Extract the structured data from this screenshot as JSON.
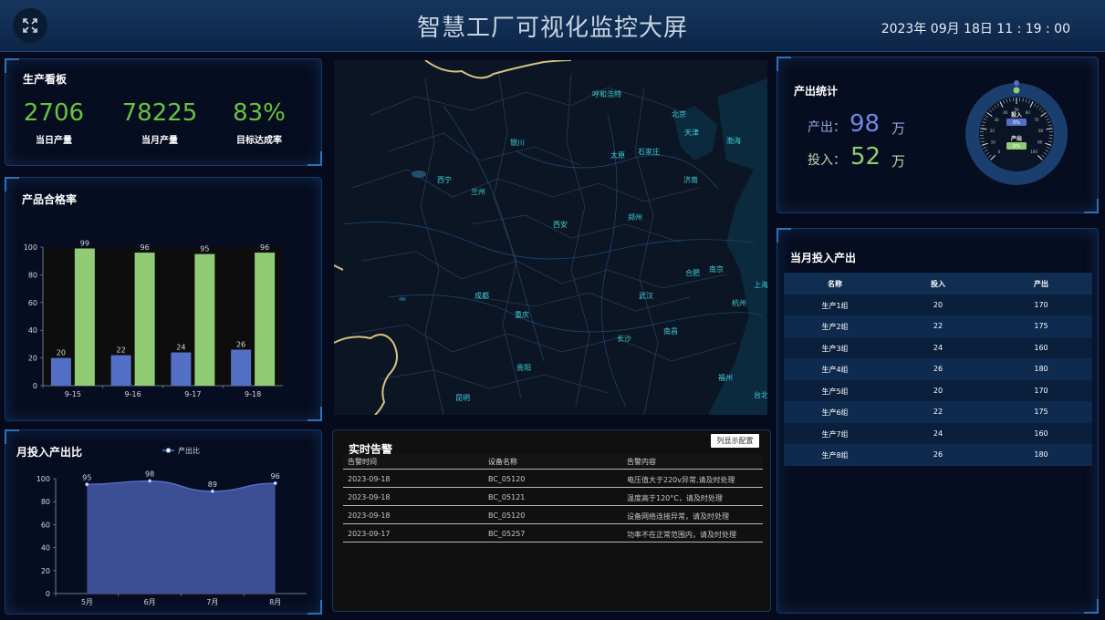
{
  "header": {
    "title": "智慧工厂可视化监控大屏",
    "datetime": "2023年 09月 18日 11 : 19 : 00"
  },
  "icons": {
    "fullscreen": "fullscreen-expand-icon"
  },
  "production_board": {
    "title": "生产看板",
    "stats": [
      {
        "value": "2706",
        "label": "当日产量"
      },
      {
        "value": "78225",
        "label": "当月产量"
      },
      {
        "value": "83%",
        "label": "目标达成率"
      }
    ]
  },
  "quality_chart": {
    "title": "产品合格率",
    "chart_data": {
      "type": "bar",
      "categories": [
        "9-15",
        "9-16",
        "9-17",
        "9-18"
      ],
      "series": [
        {
          "values": [
            20,
            22,
            24,
            26
          ],
          "color": "#5470c6"
        },
        {
          "values": [
            99,
            96,
            95,
            96
          ],
          "color": "#91cc75"
        }
      ],
      "ylim": [
        0,
        100
      ],
      "yticks": [
        0,
        20,
        40,
        60,
        80,
        100
      ]
    }
  },
  "ratio_chart": {
    "title": "月投入产出比",
    "chart_data": {
      "type": "area",
      "categories": [
        "5月",
        "6月",
        "7月",
        "8月"
      ],
      "series": [
        {
          "name": "产出比",
          "values": [
            95,
            98,
            89,
            96
          ],
          "color": "#5470c6"
        }
      ],
      "ylim": [
        0,
        100
      ],
      "yticks": [
        0,
        20,
        40,
        60,
        80,
        100
      ],
      "legend": "top-center"
    }
  },
  "map": {
    "cities": [
      "呼和浩特",
      "北京",
      "天津",
      "银川",
      "太原",
      "石家庄",
      "渤海",
      "西宁",
      "兰州",
      "济南",
      "郑州",
      "西安",
      "合肥",
      "南京",
      "成都",
      "武汉",
      "上海",
      "杭州",
      "重庆",
      "长沙",
      "南昌",
      "贵阳",
      "福州",
      "昆明",
      "台北"
    ]
  },
  "alarms": {
    "title": "实时告警",
    "config_button": "列显示配置",
    "columns": [
      "告警时间",
      "设备名称",
      "告警内容"
    ],
    "rows": [
      [
        "2023-09-18",
        "BC_05120",
        "电压值大于220v异常,请及时处理"
      ],
      [
        "2023-09-18",
        "BC_05121",
        "温度高于120°C，请及时处理"
      ],
      [
        "2023-09-18",
        "BC_05120",
        "设备网络连接异常，请及时处理"
      ],
      [
        "2023-09-17",
        "BC_05257",
        "功率不在正常范围内，请及时处理"
      ]
    ]
  },
  "output_stats": {
    "title": "产出统计",
    "output_label": "产出：",
    "output_value": "98",
    "output_unit": "万",
    "input_label": "投入：",
    "input_value": "52",
    "input_unit": "万",
    "gauge": {
      "input_label": "投入",
      "input_percent": "0%",
      "output_label": "产出",
      "output_percent": "0%",
      "ticks": [
        "0",
        "10",
        "20",
        "30",
        "40",
        "50",
        "60",
        "70",
        "80",
        "90",
        "100"
      ]
    }
  },
  "monthly_io": {
    "title": "当月投入产出",
    "columns": [
      "名称",
      "投入",
      "产出"
    ],
    "rows": [
      [
        "生产1组",
        "20",
        "170"
      ],
      [
        "生产2组",
        "22",
        "175"
      ],
      [
        "生产3组",
        "24",
        "160"
      ],
      [
        "生产4组",
        "26",
        "180"
      ],
      [
        "生产5组",
        "20",
        "170"
      ],
      [
        "生产6组",
        "22",
        "175"
      ],
      [
        "生产7组",
        "24",
        "160"
      ],
      [
        "生产8组",
        "26",
        "180"
      ]
    ]
  }
}
